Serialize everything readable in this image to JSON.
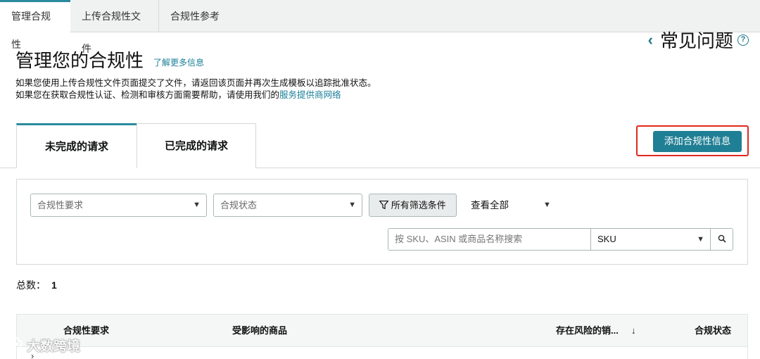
{
  "top_tabs": [
    "管理合规性",
    "上传合规性文件",
    "合规性参考"
  ],
  "faq": {
    "chevron": "‹",
    "label": "常见问题",
    "help_glyph": "?"
  },
  "page": {
    "title": "管理您的合规性",
    "learn_more": "了解更多信息",
    "desc_line1": "如果您使用上传合规性文件页面提交了文件，请返回该页面并再次生成模板以追踪批准状态。",
    "desc_line2_prefix": "如果您在获取合规性认证、检测和审核方面需要帮助，请使用我们的",
    "desc_line2_link": "服务提供商网络"
  },
  "sub_tabs": [
    "未完成的请求",
    "已完成的请求"
  ],
  "add_button": "添加合规性信息",
  "filters": {
    "requirement_placeholder": "合规性要求",
    "status_placeholder": "合规状态",
    "all_filters": "所有筛选条件",
    "view_all": "查看全部",
    "search_placeholder": "按 SKU、ASIN 或商品名称搜索",
    "search_field": "SKU"
  },
  "total": {
    "label": "总数：",
    "value": "1"
  },
  "table": {
    "headers": [
      "合规性要求",
      "受影响的商品",
      "存在风险的销...",
      "合规状态"
    ],
    "sort_arrow": "↓"
  },
  "watermark": "大数跨境",
  "colors": {
    "accent": "#1f7f94",
    "highlight_border": "#e0291f",
    "link": "#1a7f98"
  },
  "icons": [
    "help-icon",
    "chevron-left-icon",
    "filter-icon",
    "search-icon",
    "chevron-down-icon"
  ]
}
